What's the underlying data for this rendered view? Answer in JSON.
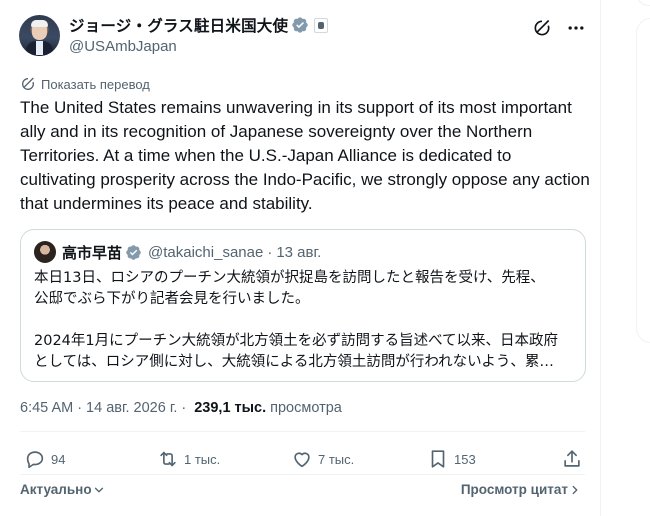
{
  "author": {
    "display_name": "ジョージ・グラス駐日米国大使",
    "handle": "@USAmbJapan"
  },
  "translate_label": "Показать перевод",
  "tweet_text": "The United States remains unwavering in its support of its most important ally and in its recognition of Japanese sovereignty over the Northern Territories. At a time when the U.S.-Japan Alliance is dedicated to cultivating prosperity across the Indo-Pacific, we strongly oppose any action that undermines its peace and stability.",
  "quote": {
    "display_name": "高市早苗",
    "handle": "@takaichi_sanae",
    "dot": "·",
    "date": "13 авг.",
    "lines": [
      "本日13日、ロシアのプーチン大統領が択捉島を訪問したと報告を受け、先程、",
      "公邸でぶら下がり記者会見を行いました。",
      "2024年1月にプーチン大統領が北方領土を必ず訪問する旨述べて以来、日本政府",
      "としては、ロシア側に対し、大統領による北方領土訪問が行われないよう、累…"
    ]
  },
  "meta": {
    "time": "6:45 AM",
    "sep": "·",
    "date": "14 авг. 2026 г.",
    "views": "239,1 тыс.",
    "views_label": "просмотра"
  },
  "stats": {
    "replies": "94",
    "reposts": "1 тыс.",
    "likes": "7 тыс.",
    "bookmarks": "153"
  },
  "footer": {
    "sort_label": "Актуально",
    "quotes_label": "Просмотр цитат"
  },
  "colors": {
    "verified": "#829aab",
    "text": "#0f1419",
    "secondary": "#536471",
    "border": "#cfd9de"
  },
  "icons": [
    "verified-badge-icon",
    "affiliate-badge-icon",
    "grok-icon",
    "more-icon",
    "translate-icon",
    "reply-icon",
    "repost-icon",
    "like-icon",
    "bookmark-icon",
    "share-icon",
    "chevron-down-icon",
    "chevron-right-icon"
  ]
}
